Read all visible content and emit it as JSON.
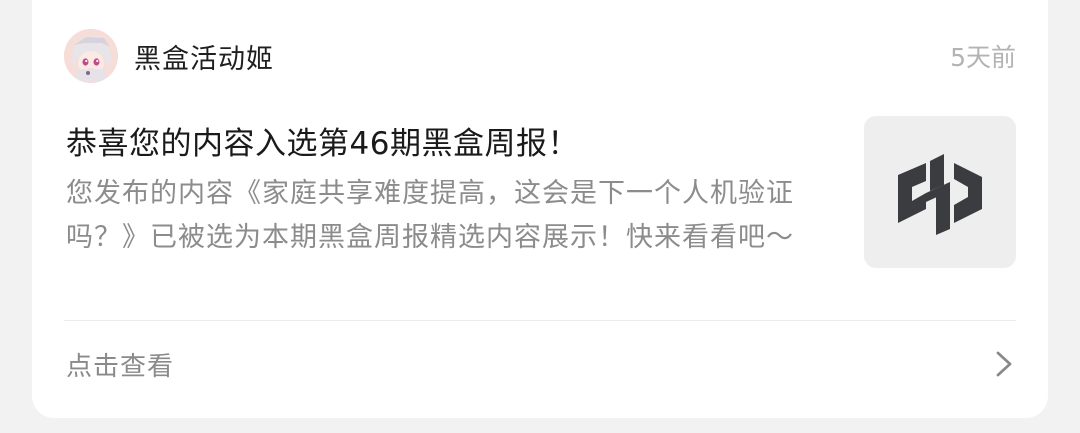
{
  "notification": {
    "sender": "黑盒活动姬",
    "time": "5天前",
    "title": "恭喜您的内容入选第46期黑盒周报！",
    "body": "您发布的内容《家庭共享难度提高，这会是下一个人机验证吗？》已被选为本期黑盒周报精选内容展示！快来看看吧～",
    "avatar_icon": "anime-girl-avatar",
    "thumbnail_icon": "heybox-logo-icon",
    "logo_color": "#3a3c40",
    "footer_label": "点击查看",
    "footer_icon": "chevron-right-icon"
  }
}
